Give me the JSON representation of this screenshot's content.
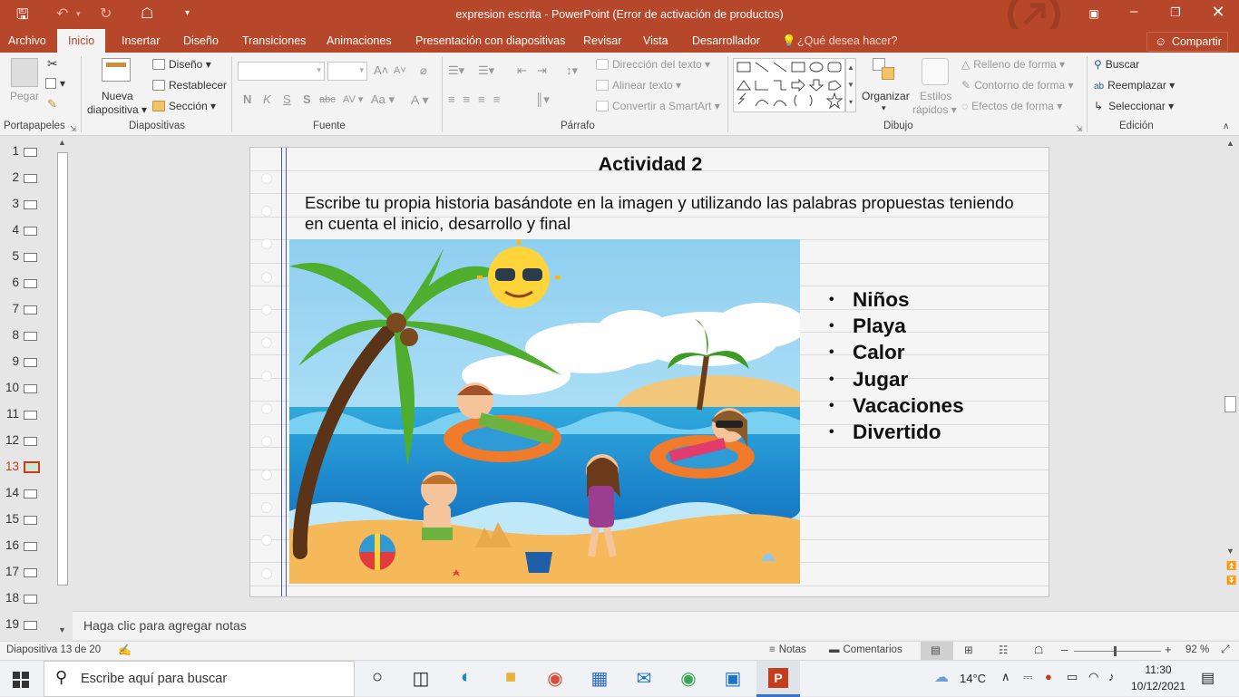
{
  "window": {
    "title": "expresion escrita - PowerPoint (Error de activación de productos)"
  },
  "tabs": [
    "Archivo",
    "Inicio",
    "Insertar",
    "Diseño",
    "Transiciones",
    "Animaciones",
    "Presentación con diapositivas",
    "Revisar",
    "Vista",
    "Desarrollador"
  ],
  "tell_me": "¿Qué desea hacer?",
  "share": "Compartir",
  "ribbon": {
    "portapapeles": {
      "paste": "Pegar",
      "group": "Portapapeles"
    },
    "diapositivas": {
      "new1": "Nueva",
      "new2": "diapositiva",
      "layout": "Diseño",
      "reset": "Restablecer",
      "section": "Sección",
      "group": "Diapositivas"
    },
    "fuente": {
      "bold": "N",
      "italic": "K",
      "underline": "S",
      "strike": "S",
      "spacing": "abc",
      "case": "Aa",
      "group": "Fuente"
    },
    "parrafo": {
      "direction": "Dirección del texto",
      "align": "Alinear texto",
      "smartart": "Convertir a SmartArt",
      "group": "Párrafo"
    },
    "dibujo": {
      "organize": "Organizar",
      "styles1": "Estilos",
      "styles2": "rápidos",
      "fill": "Relleno de forma",
      "outline": "Contorno de forma",
      "effects": "Efectos de forma",
      "group": "Dibujo"
    },
    "edicion": {
      "find": "Buscar",
      "replace": "Reemplazar",
      "select": "Seleccionar",
      "group": "Edición"
    }
  },
  "slides": [
    "1",
    "2",
    "3",
    "4",
    "5",
    "6",
    "7",
    "8",
    "9",
    "10",
    "11",
    "12",
    "13",
    "14",
    "15",
    "16",
    "17",
    "18",
    "19"
  ],
  "slide": {
    "title": "Actividad 2",
    "body": "Escribe tu propia historia basándote en la imagen y utilizando las palabras propuestas teniendo en cuenta el inicio, desarrollo y final",
    "words": [
      "Niños",
      "Playa",
      "Calor",
      "Jugar",
      "Vacaciones",
      "Divertido"
    ],
    "bullet": "•"
  },
  "notes_placeholder": "Haga clic para agregar notas",
  "status": {
    "slide_info": "Diapositiva 13 de 20",
    "notes": "Notas",
    "comments": "Comentarios",
    "zoom": "92 %",
    "zoom_level": 0.46
  },
  "taskbar": {
    "search": "Escribe aquí para buscar",
    "temp": "14°C",
    "time": "11:30",
    "date": "10/12/2021"
  },
  "colors": {
    "accent": "#b7472a",
    "selected_slide": "#c43e1c",
    "slide_line": "#4a5f9a"
  }
}
